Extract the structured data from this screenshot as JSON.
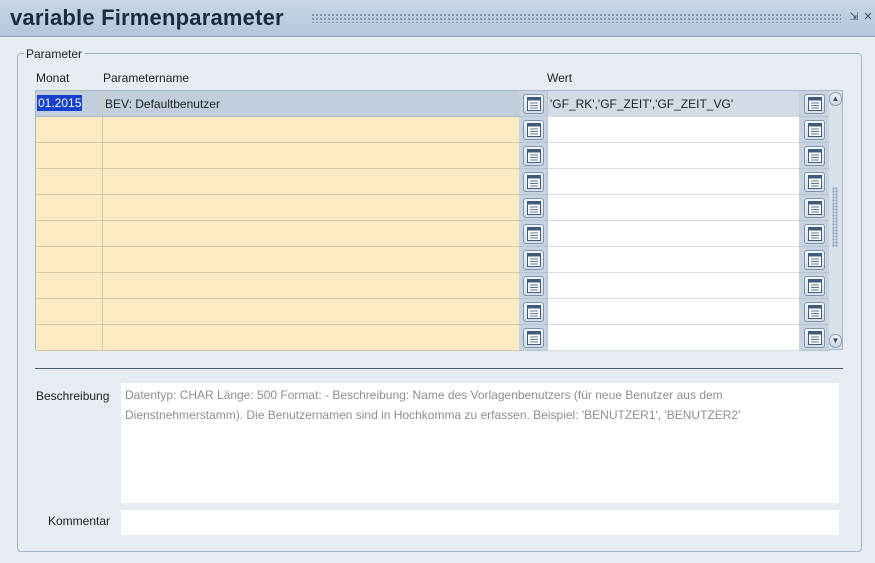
{
  "window": {
    "title": "variable Firmenparameter",
    "minimize_icon": "minimize-icon",
    "close_icon": "close-icon"
  },
  "group": {
    "legend": "Parameter"
  },
  "columns": {
    "monat": "Monat",
    "parametername": "Parametername",
    "wert": "Wert"
  },
  "rows": [
    {
      "monat": "01.2015",
      "parametername": "BEV: Defaultbenutzer",
      "wert": "'GF_RK','GF_ZEIT','GF_ZEIT_VG'"
    },
    {
      "monat": "",
      "parametername": "",
      "wert": ""
    },
    {
      "monat": "",
      "parametername": "",
      "wert": ""
    },
    {
      "monat": "",
      "parametername": "",
      "wert": ""
    },
    {
      "monat": "",
      "parametername": "",
      "wert": ""
    },
    {
      "monat": "",
      "parametername": "",
      "wert": ""
    },
    {
      "monat": "",
      "parametername": "",
      "wert": ""
    },
    {
      "monat": "",
      "parametername": "",
      "wert": ""
    },
    {
      "monat": "",
      "parametername": "",
      "wert": ""
    },
    {
      "monat": "",
      "parametername": "",
      "wert": ""
    }
  ],
  "row_button_icon": "list-icon",
  "beschreibung": {
    "label": "Beschreibung",
    "text": "Datentyp: CHAR Länge: 500 Format: - Beschreibung: Name des Vorlagenbenutzers (für neue Benutzer aus dem Dienstnehmerstamm). Die Benutzernamen sind in Hochkomma zu erfassen. Beispiel: 'BENUTZER1', 'BENUTZER2'"
  },
  "kommentar": {
    "label": "Kommentar",
    "value": ""
  },
  "colors": {
    "titlebar": "#b3c6da",
    "cell_yellow": "#fbeac2",
    "selection": "#1540d0"
  }
}
